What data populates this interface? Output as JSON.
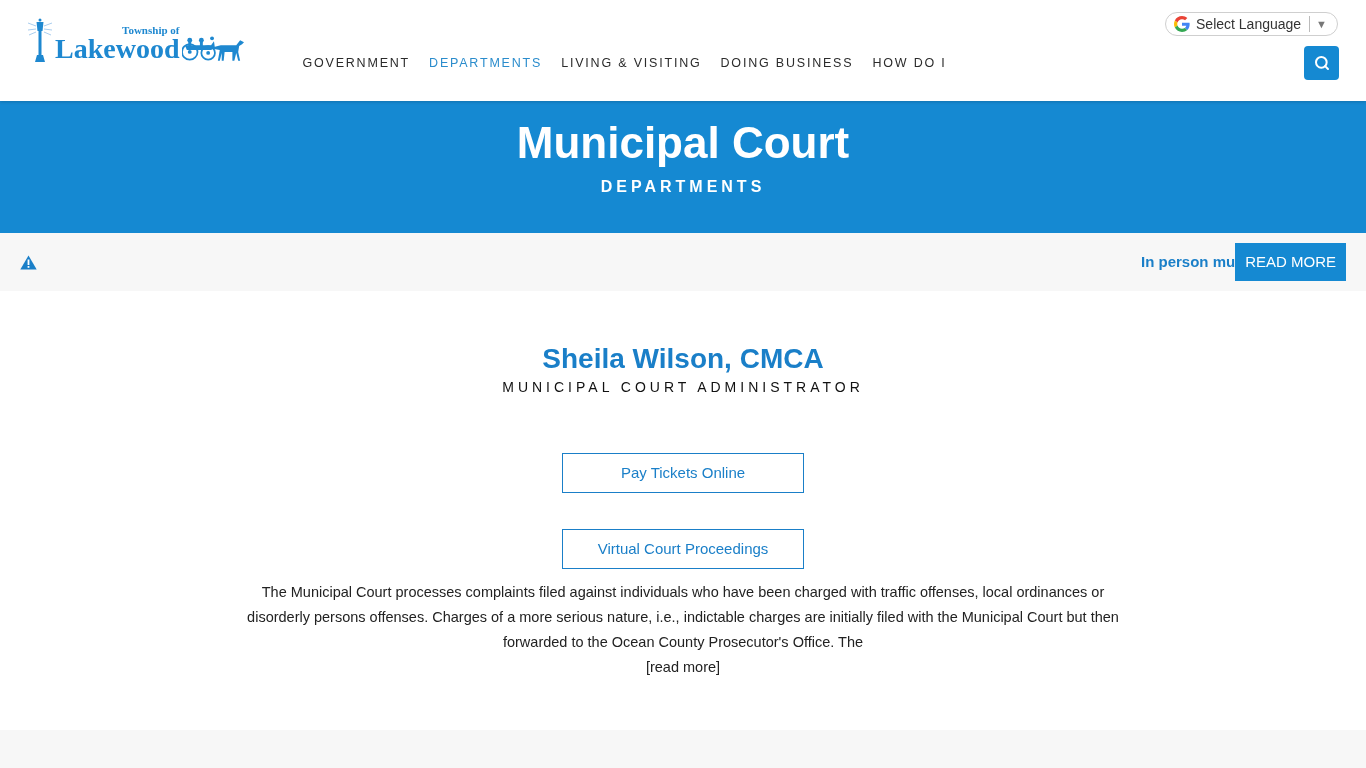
{
  "header": {
    "logo": {
      "tagline": "Township of",
      "wordmark": "Lakewood"
    },
    "nav": [
      {
        "label": "GOVERNMENT",
        "selected": false
      },
      {
        "label": "DEPARTMENTS",
        "selected": true
      },
      {
        "label": "LIVING & VISITING",
        "selected": false
      },
      {
        "label": "DOING BUSINESS",
        "selected": false
      },
      {
        "label": "HOW DO I",
        "selected": false
      }
    ],
    "language_selector": {
      "label": "Select Language",
      "arrow": "▼"
    }
  },
  "banner": {
    "title": "Municipal Court",
    "subtitle": "DEPARTMENTS"
  },
  "alert": {
    "text": "In person mu",
    "button": "READ MORE"
  },
  "contact": {
    "name": "Sheila Wilson, CMCA",
    "role": "MUNICIPAL COURT ADMINISTRATOR"
  },
  "buttons": [
    "Pay Tickets Online",
    "Virtual Court Proceedings"
  ],
  "description": {
    "text": "The Municipal Court processes complaints filed against individuals who have been charged with traffic offenses, local ordinances or disorderly persons offenses. Charges of a more serious nature, i.e., indictable charges are initially filed with the Municipal Court but then forwarded to the Ocean County Prosecutor's Office. The",
    "link": "[read more]"
  }
}
